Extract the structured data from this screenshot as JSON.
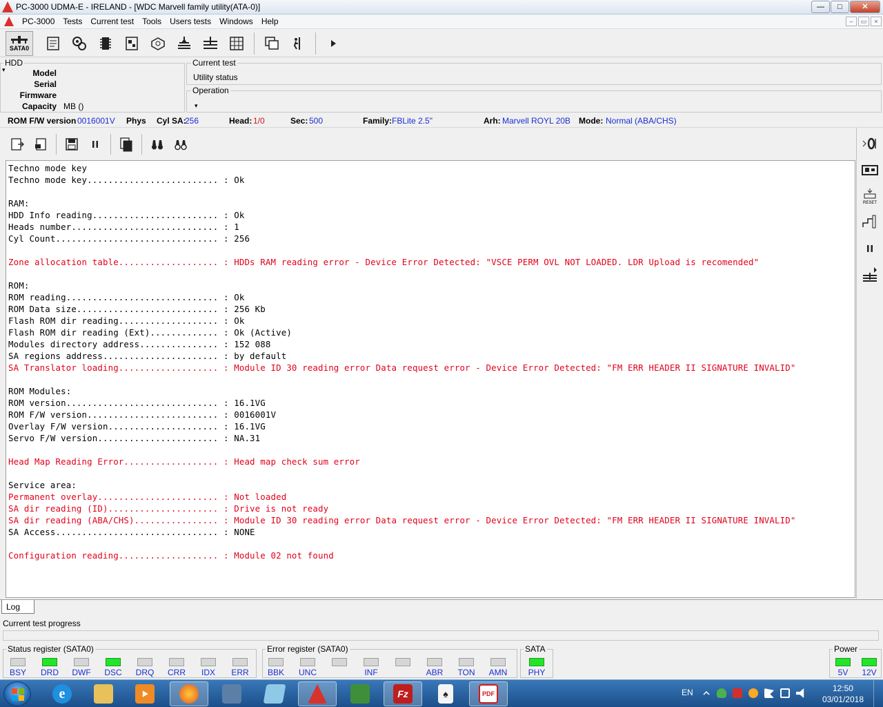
{
  "window": {
    "title": "PC-3000 UDMA-E - IRELAND - [WDC Marvell family utility(ATA-0)]",
    "btn_min": "—",
    "btn_max": "□",
    "btn_close": "✕"
  },
  "menu": {
    "items": [
      "PC-3000",
      "Tests",
      "Current test",
      "Tools",
      "Users tests",
      "Windows",
      "Help"
    ],
    "mdi_min": "–",
    "mdi_restore": "▭",
    "mdi_close": "×"
  },
  "toolbar": {
    "sata_label": "SATA0"
  },
  "hdd": {
    "legend": "HDD",
    "model_label": "Model",
    "serial_label": "Serial",
    "firmware_label": "Firmware",
    "capacity_label": "Capacity",
    "capacity_value": "MB ()",
    "dropdown_marker": "▾"
  },
  "current_test": {
    "legend": "Current test",
    "value": "Utility status"
  },
  "operation": {
    "legend": "Operation",
    "dropdown_marker": "▾"
  },
  "infoline": {
    "rom_label": "ROM F/W version",
    "rom_value": "0016001V",
    "phys_label": "Phys",
    "cylsa_label": "Cyl SA:",
    "cylsa_value": "256",
    "head_label": "Head:",
    "head_value": "1/0",
    "sec_label": "Sec:",
    "sec_value": "500",
    "family_label": "Family:",
    "family_value": "FBLite 2.5\"",
    "arh_label": "Arh:",
    "arh_value": "Marvell ROYL 20B",
    "mode_label": "Mode:",
    "mode_value": "Normal (ABA/CHS)"
  },
  "log": {
    "lines": [
      {
        "text": "Techno mode key",
        "error": false
      },
      {
        "text": "Techno mode key......................... : Ok",
        "error": false
      },
      {
        "text": "",
        "error": false
      },
      {
        "text": "RAM:",
        "error": false
      },
      {
        "text": "HDD Info reading........................ : Ok",
        "error": false
      },
      {
        "text": "Heads number............................ : 1",
        "error": false
      },
      {
        "text": "Cyl Count............................... : 256",
        "error": false
      },
      {
        "text": "",
        "error": false
      },
      {
        "text": "Zone allocation table................... : HDDs RAM reading error - Device Error Detected: \"VSCE PERM OVL NOT LOADED. LDR Upload is recomended\"",
        "error": true
      },
      {
        "text": "",
        "error": false
      },
      {
        "text": "ROM:",
        "error": false
      },
      {
        "text": "ROM reading............................. : Ok",
        "error": false
      },
      {
        "text": "ROM Data size........................... : 256 Kb",
        "error": false
      },
      {
        "text": "Flash ROM dir reading................... : Ok",
        "error": false
      },
      {
        "text": "Flash ROM dir reading (Ext)............. : Ok (Active)",
        "error": false
      },
      {
        "text": "Modules directory address............... : 152 088",
        "error": false
      },
      {
        "text": "SA regions address...................... : by default",
        "error": false
      },
      {
        "text": "SA Translator loading................... : Module ID 30 reading error Data request error - Device Error Detected: \"FM ERR HEADER II SIGNATURE INVALID\"",
        "error": true
      },
      {
        "text": "",
        "error": false
      },
      {
        "text": "ROM Modules:",
        "error": false
      },
      {
        "text": "ROM version............................. : 16.1VG",
        "error": false
      },
      {
        "text": "ROM F/W version......................... : 0016001V",
        "error": false
      },
      {
        "text": "Overlay F/W version..................... : 16.1VG",
        "error": false
      },
      {
        "text": "Servo F/W version....................... : NA.31",
        "error": false
      },
      {
        "text": "",
        "error": false
      },
      {
        "text": "Head Map Reading Error.................. : Head map check sum error",
        "error": true
      },
      {
        "text": "",
        "error": false
      },
      {
        "text": "Service area:",
        "error": false
      },
      {
        "text": "Permanent overlay....................... : Not loaded",
        "error": true
      },
      {
        "text": "SA dir reading (ID)..................... : Drive is not ready",
        "error": true
      },
      {
        "text": "SA dir reading (ABA/CHS)................ : Module ID 30 reading error Data request error - Device Error Detected: \"FM ERR HEADER II SIGNATURE INVALID\"",
        "error": true
      },
      {
        "text": "SA Access............................... : NONE",
        "error": false
      },
      {
        "text": "",
        "error": false
      },
      {
        "text": "Configuration reading................... : Module 02 not found",
        "error": true
      }
    ]
  },
  "tabs": {
    "log": "Log"
  },
  "progress": {
    "label": "Current test progress",
    "fraction": 0
  },
  "status_register": {
    "legend": "Status register (SATA0)",
    "bits": [
      {
        "label": "BSY",
        "on": false
      },
      {
        "label": "DRD",
        "on": true
      },
      {
        "label": "DWF",
        "on": false
      },
      {
        "label": "DSC",
        "on": true
      },
      {
        "label": "DRQ",
        "on": false
      },
      {
        "label": "CRR",
        "on": false
      },
      {
        "label": "IDX",
        "on": false
      },
      {
        "label": "ERR",
        "on": false
      }
    ]
  },
  "error_register": {
    "legend": "Error register (SATA0)",
    "bits": [
      {
        "label": "BBK",
        "on": false
      },
      {
        "label": "UNC",
        "on": false
      },
      {
        "label": "",
        "on": false
      },
      {
        "label": "INF",
        "on": false
      },
      {
        "label": "",
        "on": false
      },
      {
        "label": "ABR",
        "on": false
      },
      {
        "label": "TON",
        "on": false
      },
      {
        "label": "AMN",
        "on": false
      }
    ]
  },
  "sata": {
    "legend": "SATA",
    "bits": [
      {
        "label": "PHY",
        "on": true
      }
    ]
  },
  "power": {
    "legend": "Power",
    "bits": [
      {
        "label": "5V",
        "on": true
      },
      {
        "label": "12V",
        "on": true
      }
    ]
  },
  "taskbar": {
    "lang": "EN",
    "time": "12:50",
    "date": "03/01/2018",
    "filezilla_glyph": "Fz",
    "pdf_glyph": "PDF",
    "ie_glyph": "e",
    "apps": [
      "internet-explorer",
      "file-explorer",
      "media-player",
      "firefox",
      "control-panel",
      "notepad",
      "pc3000",
      "monitor",
      "filezilla",
      "solitaire",
      "pdf-reader"
    ]
  },
  "colors": {
    "error_text": "#e2001a",
    "value_blue": "#1a2ed0",
    "led_on": "#22e52a",
    "led_off": "#d6d6d6"
  }
}
